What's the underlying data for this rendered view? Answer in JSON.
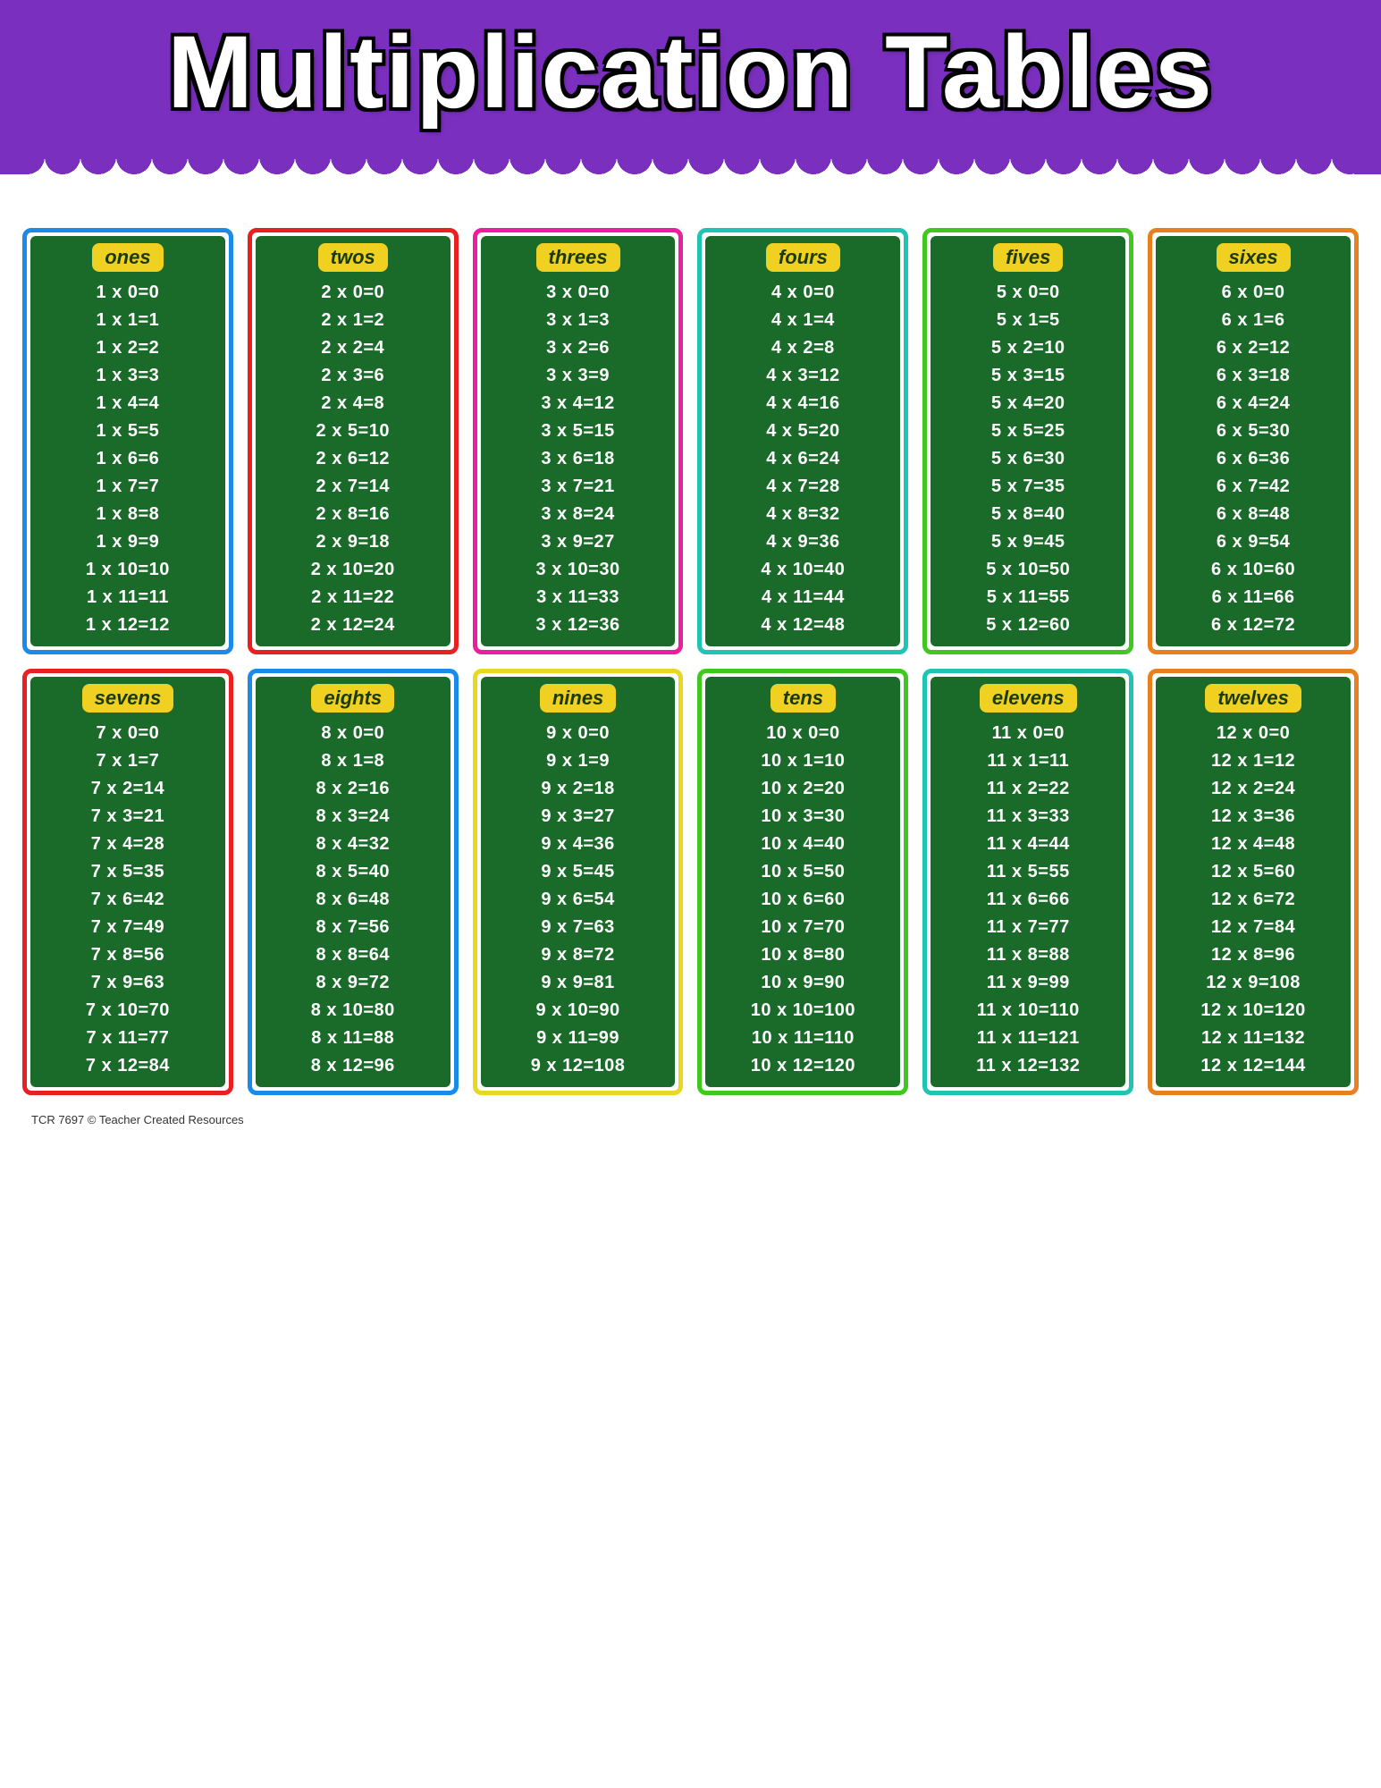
{
  "header": {
    "title": "Multiplication Tables",
    "bg_color": "#7B2FBE"
  },
  "tables": [
    {
      "id": "ones",
      "label": "ones",
      "border": "border-blue",
      "rows": [
        "1x0=0",
        "1x1=1",
        "1x2=2",
        "1x3=3",
        "1x4=4",
        "1x5=5",
        "1x6=6",
        "1x7=7",
        "1x8=8",
        "1x9=9",
        "1x10=10",
        "1x11=11",
        "1x12=12"
      ]
    },
    {
      "id": "twos",
      "label": "twos",
      "border": "border-red",
      "rows": [
        "2x0=0",
        "2x1=2",
        "2x2=4",
        "2x3=6",
        "2x4=8",
        "2x5=10",
        "2x6=12",
        "2x7=14",
        "2x8=16",
        "2x9=18",
        "2x10=20",
        "2x11=22",
        "2x12=24"
      ]
    },
    {
      "id": "threes",
      "label": "threes",
      "border": "border-pink",
      "rows": [
        "3x0=0",
        "3x1=3",
        "3x2=6",
        "3x3=9",
        "3x4=12",
        "3x5=15",
        "3x6=18",
        "3x7=21",
        "3x8=24",
        "3x9=27",
        "3x10=30",
        "3x11=33",
        "3x12=36"
      ]
    },
    {
      "id": "fours",
      "label": "fours",
      "border": "border-teal",
      "rows": [
        "4x0=0",
        "4x1=4",
        "4x2=8",
        "4x3=12",
        "4x4=16",
        "4x5=20",
        "4x6=24",
        "4x7=28",
        "4x8=32",
        "4x9=36",
        "4x10=40",
        "4x11=44",
        "4x12=48"
      ]
    },
    {
      "id": "fives",
      "label": "fives",
      "border": "border-green",
      "rows": [
        "5x0=0",
        "5x1=5",
        "5x2=10",
        "5x3=15",
        "5x4=20",
        "5x5=25",
        "5x6=30",
        "5x7=35",
        "5x8=40",
        "5x9=45",
        "5x10=50",
        "5x11=55",
        "5x12=60"
      ]
    },
    {
      "id": "sixes",
      "label": "sixes",
      "border": "border-orange",
      "rows": [
        "6x0=0",
        "6x1=6",
        "6x2=12",
        "6x3=18",
        "6x4=24",
        "6x5=30",
        "6x6=36",
        "6x7=42",
        "6x8=48",
        "6x9=54",
        "6x10=60",
        "6x11=66",
        "6x12=72"
      ]
    },
    {
      "id": "sevens",
      "label": "sevens",
      "border": "border-red",
      "rows": [
        "7x0=0",
        "7x1=7",
        "7x2=14",
        "7x3=21",
        "7x4=28",
        "7x5=35",
        "7x6=42",
        "7x7=49",
        "7x8=56",
        "7x9=63",
        "7x10=70",
        "7x11=77",
        "7x12=84"
      ]
    },
    {
      "id": "eights",
      "label": "eights",
      "border": "border-blue",
      "rows": [
        "8x0=0",
        "8x1=8",
        "8x2=16",
        "8x3=24",
        "8x4=32",
        "8x5=40",
        "8x6=48",
        "8x7=56",
        "8x8=64",
        "8x9=72",
        "8x10=80",
        "8x11=88",
        "8x12=96"
      ]
    },
    {
      "id": "nines",
      "label": "nines",
      "border": "border-yellow-border",
      "rows": [
        "9x0=0",
        "9x1=9",
        "9x2=18",
        "9x3=27",
        "9x4=36",
        "9x5=45",
        "9x6=54",
        "9x7=63",
        "9x8=72",
        "9x9=81",
        "9x10=90",
        "9x11=99",
        "9x12=108"
      ]
    },
    {
      "id": "tens",
      "label": "tens",
      "border": "border-green",
      "rows": [
        "10x0=0",
        "10x1=10",
        "10x2=20",
        "10x3=30",
        "10x4=40",
        "10x5=50",
        "10x6=60",
        "10x7=70",
        "10x8=80",
        "10x9=90",
        "10x10=100",
        "10x11=110",
        "10x12=120"
      ]
    },
    {
      "id": "elevens",
      "label": "elevens",
      "border": "border-teal",
      "rows": [
        "11x0=0",
        "11x1=11",
        "11x2=22",
        "11x3=33",
        "11x4=44",
        "11x5=55",
        "11x6=66",
        "11x7=77",
        "11x8=88",
        "11x9=99",
        "11x10=110",
        "11x11=121",
        "11x12=132"
      ]
    },
    {
      "id": "twelves",
      "label": "twelves",
      "border": "border-orange",
      "rows": [
        "12x0=0",
        "12x1=12",
        "12x2=24",
        "12x3=36",
        "12x4=48",
        "12x5=60",
        "12x6=72",
        "12x7=84",
        "12x8=96",
        "12x9=108",
        "12x10=120",
        "12x11=132",
        "12x12=144"
      ]
    }
  ],
  "footer": {
    "text": "TCR 7697  © Teacher Created Resources"
  }
}
